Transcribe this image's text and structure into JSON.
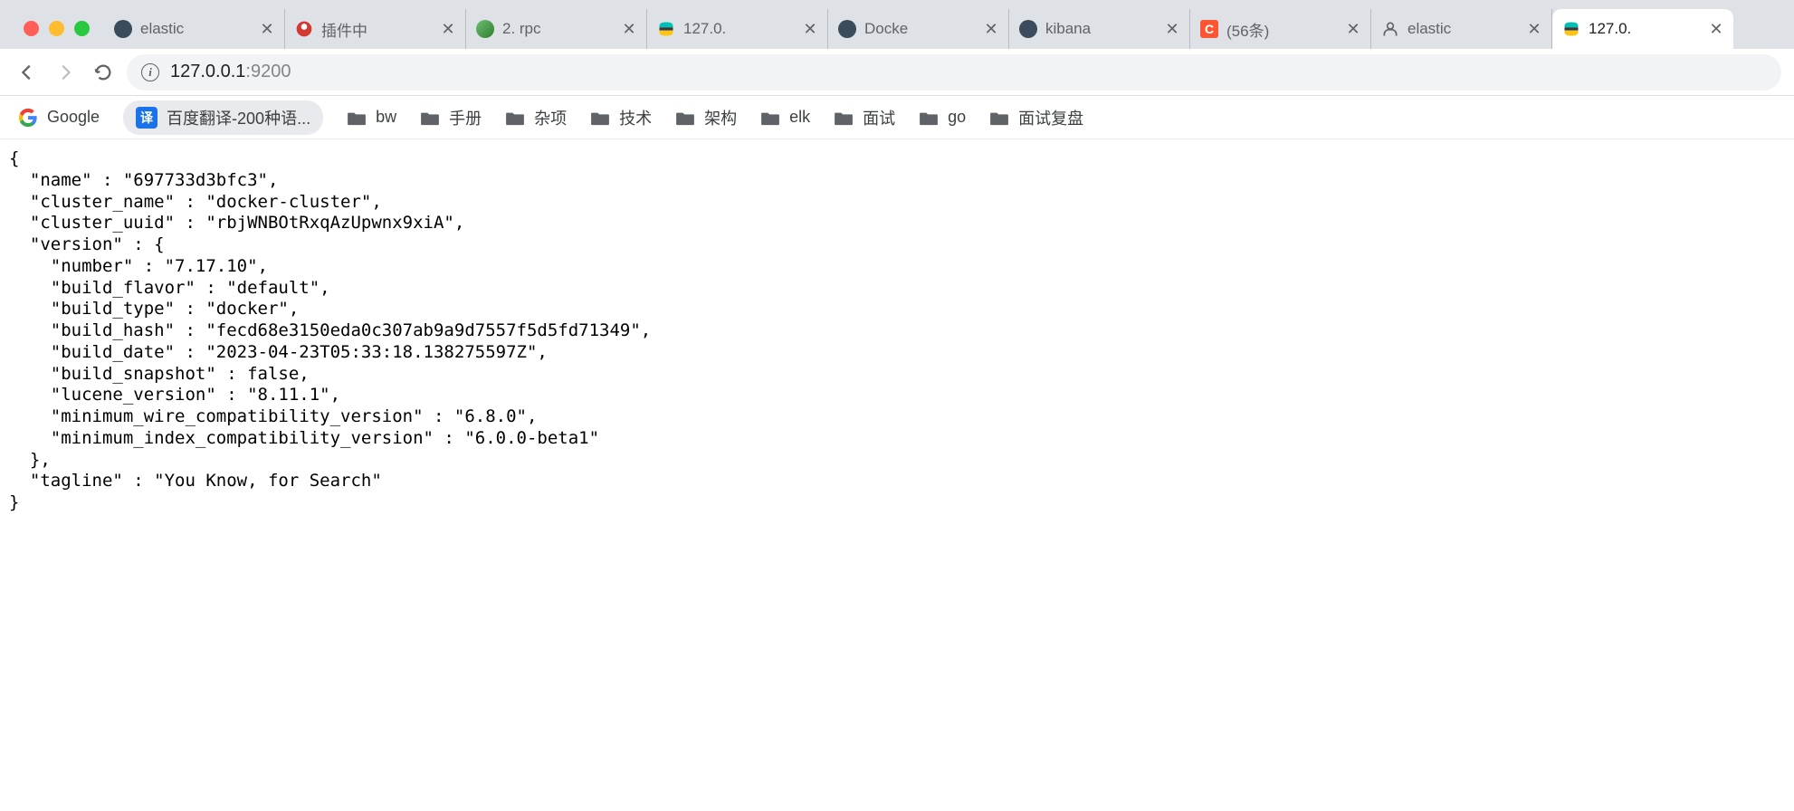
{
  "tabs": [
    {
      "title": "elastic",
      "favicon": "dark-circle"
    },
    {
      "title": "插件中",
      "favicon": "jenkins"
    },
    {
      "title": "2. rpc",
      "favicon": "green"
    },
    {
      "title": "127.0.",
      "favicon": "elastic"
    },
    {
      "title": "Docke",
      "favicon": "dark-circle"
    },
    {
      "title": "kibana",
      "favicon": "dark-circle"
    },
    {
      "title": "(56条)",
      "favicon": "csdn"
    },
    {
      "title": "elastic",
      "favicon": "person"
    },
    {
      "title": "127.0.",
      "favicon": "elastic",
      "active": true
    }
  ],
  "url": {
    "host": "127.0.0.1",
    "port": ":9200"
  },
  "bookmarks": {
    "google": "Google",
    "translate": "百度翻译-200种语...",
    "folders": [
      "bw",
      "手册",
      "杂项",
      "技术",
      "架构",
      "elk",
      "面试",
      "go",
      "面试复盘"
    ]
  },
  "response": {
    "name": "697733d3bfc3",
    "cluster_name": "docker-cluster",
    "cluster_uuid": "rbjWNBOtRxqAzUpwnx9xiA",
    "version": {
      "number": "7.17.10",
      "build_flavor": "default",
      "build_type": "docker",
      "build_hash": "fecd68e3150eda0c307ab9a9d7557f5d5fd71349",
      "build_date": "2023-04-23T05:33:18.138275597Z",
      "build_snapshot": "false",
      "lucene_version": "8.11.1",
      "minimum_wire_compatibility_version": "6.8.0",
      "minimum_index_compatibility_version": "6.0.0-beta1"
    },
    "tagline": "You Know, for Search"
  }
}
